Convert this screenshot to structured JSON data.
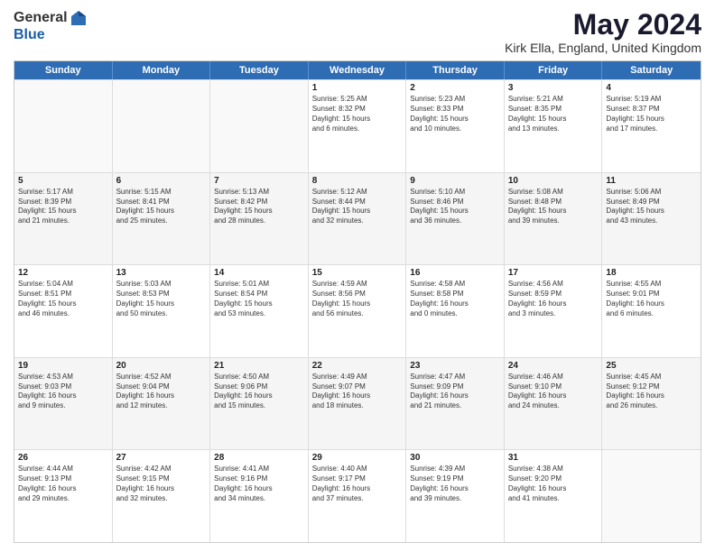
{
  "logo": {
    "general": "General",
    "blue": "Blue"
  },
  "title": "May 2024",
  "location": "Kirk Ella, England, United Kingdom",
  "header_days": [
    "Sunday",
    "Monday",
    "Tuesday",
    "Wednesday",
    "Thursday",
    "Friday",
    "Saturday"
  ],
  "rows": [
    [
      {
        "day": "",
        "info": ""
      },
      {
        "day": "",
        "info": ""
      },
      {
        "day": "",
        "info": ""
      },
      {
        "day": "1",
        "info": "Sunrise: 5:25 AM\nSunset: 8:32 PM\nDaylight: 15 hours\nand 6 minutes."
      },
      {
        "day": "2",
        "info": "Sunrise: 5:23 AM\nSunset: 8:33 PM\nDaylight: 15 hours\nand 10 minutes."
      },
      {
        "day": "3",
        "info": "Sunrise: 5:21 AM\nSunset: 8:35 PM\nDaylight: 15 hours\nand 13 minutes."
      },
      {
        "day": "4",
        "info": "Sunrise: 5:19 AM\nSunset: 8:37 PM\nDaylight: 15 hours\nand 17 minutes."
      }
    ],
    [
      {
        "day": "5",
        "info": "Sunrise: 5:17 AM\nSunset: 8:39 PM\nDaylight: 15 hours\nand 21 minutes."
      },
      {
        "day": "6",
        "info": "Sunrise: 5:15 AM\nSunset: 8:41 PM\nDaylight: 15 hours\nand 25 minutes."
      },
      {
        "day": "7",
        "info": "Sunrise: 5:13 AM\nSunset: 8:42 PM\nDaylight: 15 hours\nand 28 minutes."
      },
      {
        "day": "8",
        "info": "Sunrise: 5:12 AM\nSunset: 8:44 PM\nDaylight: 15 hours\nand 32 minutes."
      },
      {
        "day": "9",
        "info": "Sunrise: 5:10 AM\nSunset: 8:46 PM\nDaylight: 15 hours\nand 36 minutes."
      },
      {
        "day": "10",
        "info": "Sunrise: 5:08 AM\nSunset: 8:48 PM\nDaylight: 15 hours\nand 39 minutes."
      },
      {
        "day": "11",
        "info": "Sunrise: 5:06 AM\nSunset: 8:49 PM\nDaylight: 15 hours\nand 43 minutes."
      }
    ],
    [
      {
        "day": "12",
        "info": "Sunrise: 5:04 AM\nSunset: 8:51 PM\nDaylight: 15 hours\nand 46 minutes."
      },
      {
        "day": "13",
        "info": "Sunrise: 5:03 AM\nSunset: 8:53 PM\nDaylight: 15 hours\nand 50 minutes."
      },
      {
        "day": "14",
        "info": "Sunrise: 5:01 AM\nSunset: 8:54 PM\nDaylight: 15 hours\nand 53 minutes."
      },
      {
        "day": "15",
        "info": "Sunrise: 4:59 AM\nSunset: 8:56 PM\nDaylight: 15 hours\nand 56 minutes."
      },
      {
        "day": "16",
        "info": "Sunrise: 4:58 AM\nSunset: 8:58 PM\nDaylight: 16 hours\nand 0 minutes."
      },
      {
        "day": "17",
        "info": "Sunrise: 4:56 AM\nSunset: 8:59 PM\nDaylight: 16 hours\nand 3 minutes."
      },
      {
        "day": "18",
        "info": "Sunrise: 4:55 AM\nSunset: 9:01 PM\nDaylight: 16 hours\nand 6 minutes."
      }
    ],
    [
      {
        "day": "19",
        "info": "Sunrise: 4:53 AM\nSunset: 9:03 PM\nDaylight: 16 hours\nand 9 minutes."
      },
      {
        "day": "20",
        "info": "Sunrise: 4:52 AM\nSunset: 9:04 PM\nDaylight: 16 hours\nand 12 minutes."
      },
      {
        "day": "21",
        "info": "Sunrise: 4:50 AM\nSunset: 9:06 PM\nDaylight: 16 hours\nand 15 minutes."
      },
      {
        "day": "22",
        "info": "Sunrise: 4:49 AM\nSunset: 9:07 PM\nDaylight: 16 hours\nand 18 minutes."
      },
      {
        "day": "23",
        "info": "Sunrise: 4:47 AM\nSunset: 9:09 PM\nDaylight: 16 hours\nand 21 minutes."
      },
      {
        "day": "24",
        "info": "Sunrise: 4:46 AM\nSunset: 9:10 PM\nDaylight: 16 hours\nand 24 minutes."
      },
      {
        "day": "25",
        "info": "Sunrise: 4:45 AM\nSunset: 9:12 PM\nDaylight: 16 hours\nand 26 minutes."
      }
    ],
    [
      {
        "day": "26",
        "info": "Sunrise: 4:44 AM\nSunset: 9:13 PM\nDaylight: 16 hours\nand 29 minutes."
      },
      {
        "day": "27",
        "info": "Sunrise: 4:42 AM\nSunset: 9:15 PM\nDaylight: 16 hours\nand 32 minutes."
      },
      {
        "day": "28",
        "info": "Sunrise: 4:41 AM\nSunset: 9:16 PM\nDaylight: 16 hours\nand 34 minutes."
      },
      {
        "day": "29",
        "info": "Sunrise: 4:40 AM\nSunset: 9:17 PM\nDaylight: 16 hours\nand 37 minutes."
      },
      {
        "day": "30",
        "info": "Sunrise: 4:39 AM\nSunset: 9:19 PM\nDaylight: 16 hours\nand 39 minutes."
      },
      {
        "day": "31",
        "info": "Sunrise: 4:38 AM\nSunset: 9:20 PM\nDaylight: 16 hours\nand 41 minutes."
      },
      {
        "day": "",
        "info": ""
      }
    ]
  ]
}
